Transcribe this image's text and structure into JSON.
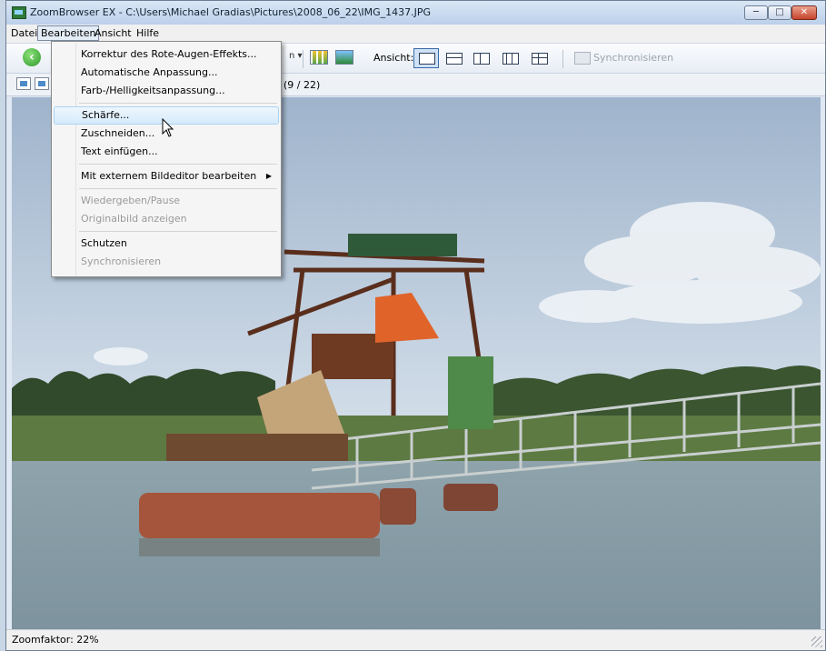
{
  "window": {
    "title": "ZoomBrowser EX - C:\\Users\\Michael Gradias\\Pictures\\2008_06_22\\IMG_1437.JPG",
    "controls": {
      "minimize": "─",
      "maximize": "□",
      "close": "✕"
    }
  },
  "menubar": {
    "items": [
      "Datei",
      "Bearbeiten",
      "Ansicht",
      "Hilfe"
    ],
    "active": "Bearbeiten"
  },
  "toolbar": {
    "dropdown_glyph": "n ▾",
    "view_label": "Ansicht:",
    "view_options": [
      "single",
      "horizontal-split",
      "vertical-split",
      "three-columns",
      "four-quadrants"
    ],
    "selected_view": "single",
    "sync_label": "Synchronisieren"
  },
  "infobar": {
    "file_counter": "G (9 / 22)"
  },
  "edit_menu": {
    "groups": [
      [
        {
          "label": "Korrektur des Rote-Augen-Effekts...",
          "enabled": true
        },
        {
          "label": "Automatische Anpassung...",
          "enabled": true
        },
        {
          "label": "Farb-/Helligkeitsanpassung...",
          "enabled": true
        }
      ],
      [
        {
          "label": "Schärfe...",
          "enabled": true,
          "hovered": true
        },
        {
          "label": "Zuschneiden...",
          "enabled": true
        },
        {
          "label": "Text einfügen...",
          "enabled": true
        }
      ],
      [
        {
          "label": "Mit externem Bildeditor bearbeiten",
          "enabled": true,
          "submenu": true
        }
      ],
      [
        {
          "label": "Wiedergeben/Pause",
          "enabled": false
        },
        {
          "label": "Originalbild anzeigen",
          "enabled": false
        }
      ],
      [
        {
          "label": "Schutzen",
          "enabled": true
        },
        {
          "label": "Synchronisieren",
          "enabled": false
        }
      ]
    ],
    "submenu_arrow": "▶"
  },
  "statusbar": {
    "zoom_text": "Zoomfaktor: 22%"
  },
  "colors": {
    "sky_top": "#9fb4cc",
    "sky_bottom": "#d8e2ec",
    "water": "#7d939e",
    "rust": "#8a4a2a",
    "pontoon": "#a5553c",
    "orange_bucket": "#e0642a",
    "green_machine": "#4f8a4a"
  }
}
